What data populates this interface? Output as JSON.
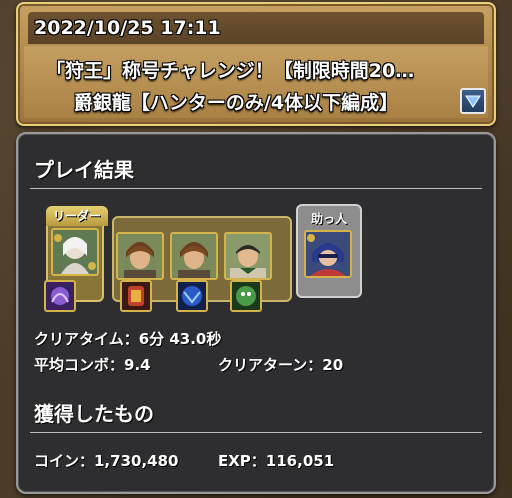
{
  "header": {
    "date": "2022/10/25 17:11",
    "title_line1": "「狩王」称号チャレンジ！【制限時間20…",
    "title_line2": "爵銀龍【ハンターのみ/4体以下編成】"
  },
  "result": {
    "section_title": "プレイ結果",
    "leader_label": "リーダー",
    "helper_label": "助っ人",
    "clear_time": "クリアタイム：6分 43.0秒",
    "avg_combo": "平均コンボ：9.4",
    "clear_turns": "クリアターン：20"
  },
  "rewards": {
    "section_title": "獲得したもの",
    "coins": "コイン：1,730,480",
    "exp": "EXP：116,051"
  },
  "team": {
    "leader": {
      "icon": "white-haired-hunter-icon",
      "color": "#6f8b5a"
    },
    "subs": [
      {
        "icon": "brown-haired-hunter-icon",
        "color": "#a07a4a"
      },
      {
        "icon": "brown-haired-hunter-icon",
        "color": "#a07a4a"
      },
      {
        "icon": "dark-haired-hunter-icon",
        "color": "#8a9a5a"
      }
    ],
    "helper": {
      "icon": "blue-ninja-icon",
      "color": "#4a6aa0"
    },
    "assists": [
      {
        "icon": "purple-assist-icon",
        "color": "#6a3fa0"
      },
      {
        "icon": "red-assist-icon",
        "color": "#a03a2a"
      },
      {
        "icon": "blue-assist-icon",
        "color": "#2a4aa0"
      },
      {
        "icon": "green-assist-icon",
        "color": "#3a7a3a"
      }
    ]
  }
}
